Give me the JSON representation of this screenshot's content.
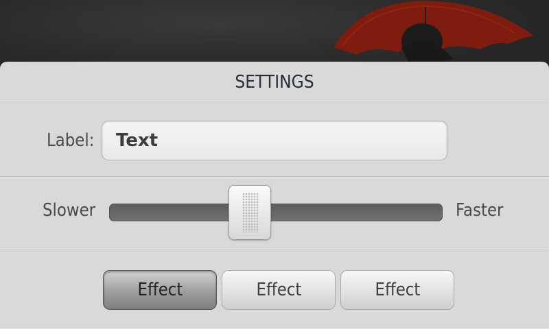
{
  "title": "SETTINGS",
  "label_row": {
    "label": "Label:",
    "input_value": "Text"
  },
  "speed_slider": {
    "min_label": "Slower",
    "max_label": "Faster",
    "value_fraction": 0.4
  },
  "effects": [
    {
      "label": "Effect",
      "selected": true
    },
    {
      "label": "Effect",
      "selected": false
    },
    {
      "label": "Effect",
      "selected": false
    }
  ],
  "colors": {
    "panel": "#d9d9d9",
    "title_text": "#243036",
    "umbrella": "#8a1f10",
    "track": "#666666"
  },
  "icons": {
    "slider_thumb": "grip-dots-icon"
  }
}
